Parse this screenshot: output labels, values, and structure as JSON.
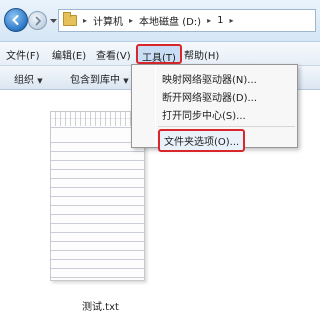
{
  "address_bar": {
    "breadcrumbs": [
      "计算机",
      "本地磁盘 (D:)",
      "1"
    ]
  },
  "menubar": {
    "items": [
      {
        "label": "文件(F)"
      },
      {
        "label": "编辑(E)"
      },
      {
        "label": "查看(V)"
      },
      {
        "label": "工具(T)"
      },
      {
        "label": "帮助(H)"
      }
    ]
  },
  "toolbar": {
    "organize_label": "组织",
    "include_label": "包含到库中"
  },
  "tools_menu": {
    "items": [
      {
        "label": "映射网络驱动器(N)..."
      },
      {
        "label": "断开网络驱动器(D)..."
      },
      {
        "label": "打开同步中心(S)..."
      },
      {
        "label": "文件夹选项(O)..."
      }
    ]
  },
  "file": {
    "name": "测试.txt"
  },
  "colors": {
    "highlight_border": "#d9262b",
    "menu_active_bg": "#c9def5"
  },
  "icons": [
    "back-arrow-icon",
    "forward-arrow-icon",
    "folder-icon",
    "chevron-right-icon",
    "dropdown-caret-icon",
    "text-file-icon"
  ]
}
